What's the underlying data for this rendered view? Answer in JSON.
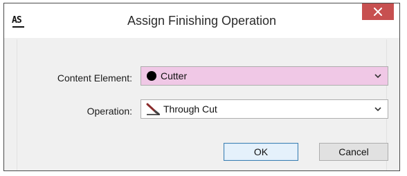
{
  "window": {
    "title": "Assign Finishing Operation",
    "app_icon_text": "AS"
  },
  "form": {
    "content_element_label": "Content Element:",
    "content_element_value": "Cutter",
    "content_element_color": "#f0c8e6",
    "operation_label": "Operation:",
    "operation_value": "Through Cut"
  },
  "buttons": {
    "ok_label": "OK",
    "cancel_label": "Cancel"
  },
  "icons": {
    "close": "close-icon",
    "content_swatch": "black-dot-icon",
    "operation": "knife-cut-icon",
    "dropdown": "chevron-down-icon"
  }
}
